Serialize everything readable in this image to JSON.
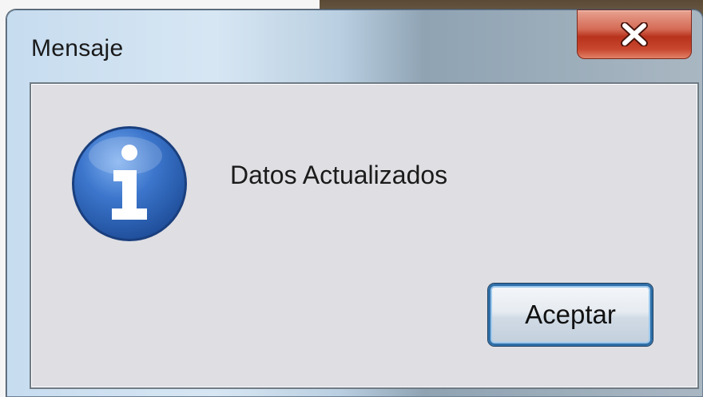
{
  "window": {
    "title": "Mensaje",
    "close_icon": "close-icon"
  },
  "dialog": {
    "icon": "info-icon",
    "message": "Datos Actualizados",
    "ok_label": "Aceptar"
  },
  "colors": {
    "client_bg": "#dedee3",
    "close_red": "#c8472e",
    "icon_blue": "#2a63b5",
    "button_border": "#2f6fa8"
  }
}
